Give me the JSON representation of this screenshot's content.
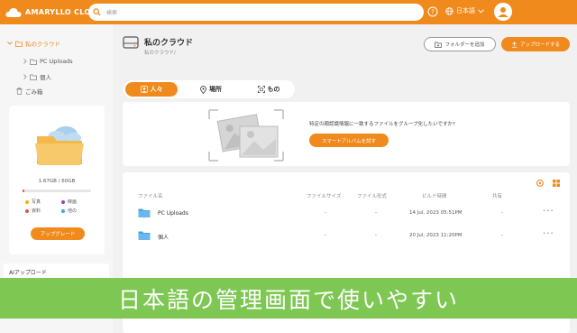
{
  "header": {
    "logo_text": "AMARYLLO CLOUD",
    "search_placeholder": "検索",
    "language": "日本語"
  },
  "sidebar": {
    "my_cloud": "私のクラウド",
    "pc_uploads": "PC Uploads",
    "personal": "個人",
    "trash": "ごみ箱",
    "storage_text": "1.67GB / 60GB",
    "storage_used_fraction": 0.028,
    "legend": [
      {
        "label": "写真",
        "color": "#f0b000"
      },
      {
        "label": "映画",
        "color": "#9b3fc4"
      },
      {
        "label": "資料",
        "color": "#d9534f"
      },
      {
        "label": "他の",
        "color": "#3fa7e0"
      }
    ],
    "upgrade_label": "アップグレード",
    "ai_upload": "AIアップロード"
  },
  "main": {
    "title": "私のクラウド",
    "breadcrumb": "私のクラウド/",
    "add_folder_label": "フォルダーを追加",
    "upload_label": "アップロードする",
    "tabs": [
      {
        "label": "人々",
        "active": true
      },
      {
        "label": "場所",
        "active": false
      },
      {
        "label": "もの",
        "active": false
      }
    ],
    "album_prompt": "特定の顔認識情報に一致するファイルをグループ化したいですか?",
    "album_button": "スマートアルバムを試す",
    "columns": [
      "ファイル名",
      "ファイルサイズ",
      "ファイル形式",
      "ビルド時間",
      "共有"
    ],
    "files": [
      {
        "name": "PC Uploads",
        "size": "-",
        "type": "-",
        "time": "14 Jul, 2023 05:51PM",
        "shared": "-",
        "more": "•••"
      },
      {
        "name": "個人",
        "size": "-",
        "type": "-",
        "time": "20 Jul, 2023 11:20PM",
        "shared": "-",
        "more": "•••"
      }
    ]
  },
  "banner": {
    "text": "日本語の管理画面で使いやすい"
  }
}
